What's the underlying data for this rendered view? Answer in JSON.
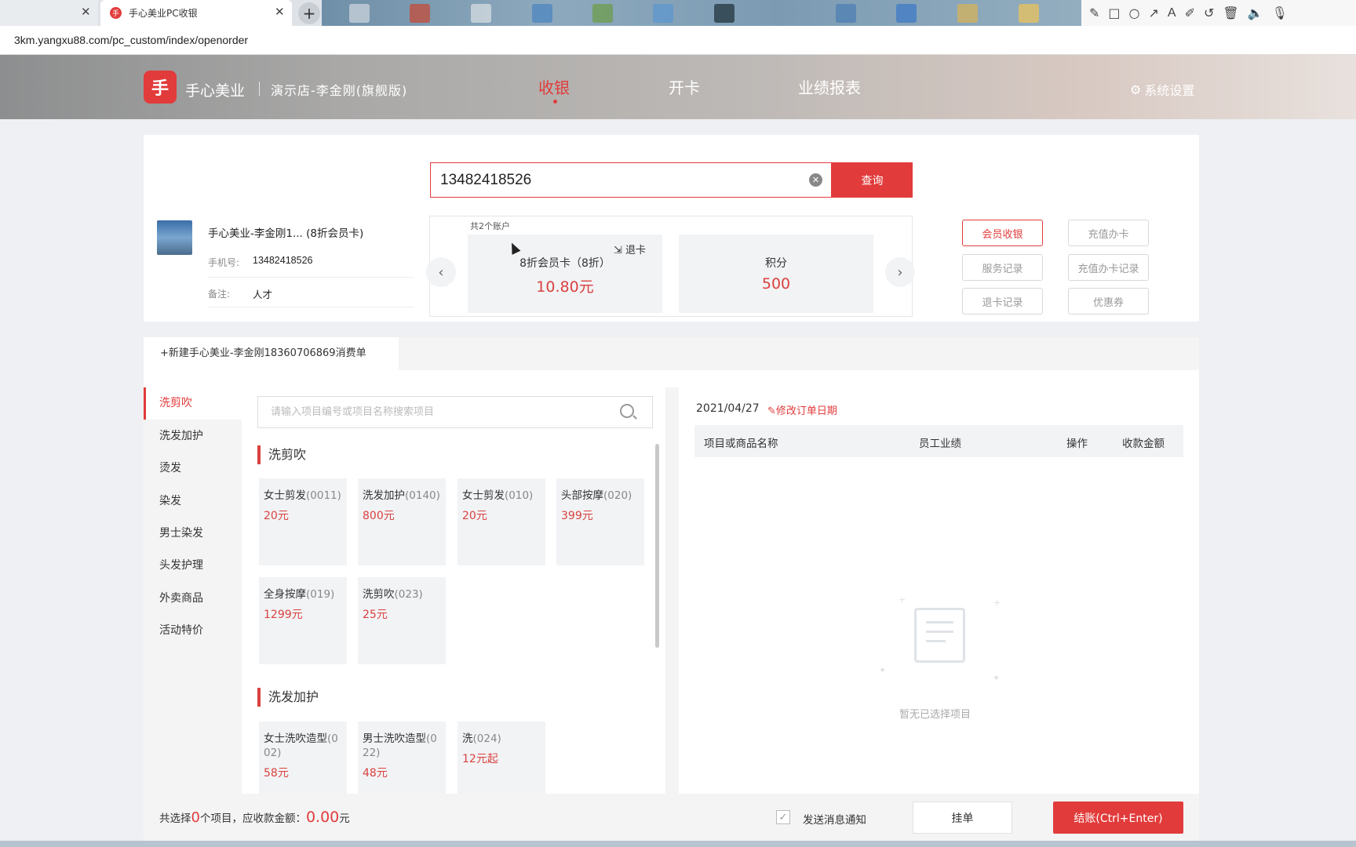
{
  "browser": {
    "tab_active_title": "手心美业PC收银",
    "favicon_glyph": "手",
    "close_glyph": "✕",
    "new_tab_glyph": "+",
    "address": "3km.yangxu88.com/pc_custom/index/openorder"
  },
  "header": {
    "logo_glyph": "手",
    "brand": "手心美业",
    "store": "演示店-李金刚(旗舰版)",
    "nav": [
      "收银",
      "开卡",
      "业绩报表"
    ],
    "settings_icon": "⚙",
    "settings_label": "系统设置"
  },
  "search": {
    "value": "13482418526",
    "clear_glyph": "✕",
    "button": "查询"
  },
  "member": {
    "name": "手心美业-李金刚1... (8折会员卡)",
    "phone_label": "手机号:",
    "phone": "13482418526",
    "note_label": "备注:",
    "note": "人才"
  },
  "accounts": {
    "count_text": "共2个账户",
    "prev_glyph": "‹",
    "next_glyph": "›",
    "refund_icon": "⇲",
    "refund_label": "退卡",
    "cards": [
      {
        "title": "8折会员卡（8折）",
        "value": "10.80元"
      },
      {
        "title": "积分",
        "value": "500"
      }
    ]
  },
  "actions": {
    "member_checkout": "会员收银",
    "recharge": "充值办卡",
    "service_records": "服务记录",
    "recharge_records": "充值办卡记录",
    "refund_records": "退卡记录",
    "coupons": "优惠券"
  },
  "order": {
    "tab_label": "+新建手心美业-李金刚18360706869消费单",
    "categories": [
      "洗剪吹",
      "洗发加护",
      "烫发",
      "染发",
      "男士染发",
      "头发护理",
      "外卖商品",
      "活动特价"
    ],
    "item_search_placeholder": "请输入项目编号或项目名称搜索项目",
    "sections": [
      {
        "title": "洗剪吹",
        "items": [
          {
            "name": "女士剪发",
            "code": "(0011)",
            "price": "20元"
          },
          {
            "name": "洗发加护",
            "code": "(0140)",
            "price": "800元"
          },
          {
            "name": "女士剪发",
            "code": "(010)",
            "price": "20元"
          },
          {
            "name": "头部按摩",
            "code": "(020)",
            "price": "399元"
          },
          {
            "name": "全身按摩",
            "code": "(019)",
            "price": "1299元"
          },
          {
            "name": "洗剪吹",
            "code": "(023)",
            "price": "25元"
          }
        ]
      },
      {
        "title": "洗发加护",
        "items": [
          {
            "name": "女士洗吹造型",
            "code": "(002)",
            "price": "58元"
          },
          {
            "name": "男士洗吹造型",
            "code": "(022)",
            "price": "48元"
          },
          {
            "name": "洗",
            "code": "(024)",
            "price": "12元起"
          }
        ]
      }
    ],
    "date": "2021/04/27",
    "edit_date_icon": "✎",
    "edit_date": "修改订单日期",
    "columns": [
      "项目或商品名称",
      "员工业绩",
      "操作",
      "收款金额"
    ],
    "empty_text": "暂无已选择项目"
  },
  "footer": {
    "summary_prefix": "共选择",
    "count": "0",
    "summary_mid": "个项目，应收款金额：",
    "amount": "0.00",
    "summary_suffix": "元",
    "notify_check_glyph": "✓",
    "notify_label": "发送消息通知",
    "hold": "挂单",
    "checkout": "结账(Ctrl+Enter)"
  },
  "colors": {
    "accent": "#e23b3b",
    "price": "#d9413f"
  }
}
